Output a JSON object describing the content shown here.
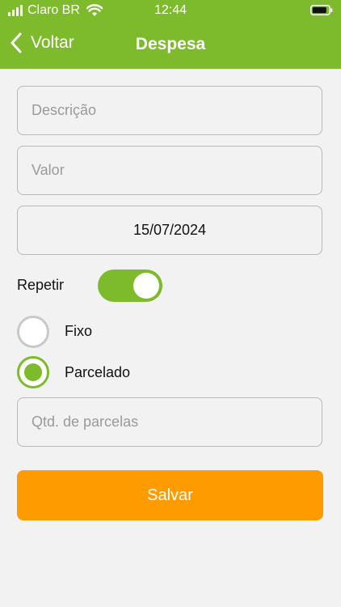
{
  "status_bar": {
    "carrier": "Claro BR",
    "time": "12:44",
    "icons": [
      "signal-icon",
      "wifi-icon",
      "battery-icon"
    ]
  },
  "nav": {
    "back_label": "Voltar",
    "title": "Despesa"
  },
  "form": {
    "descricao_placeholder": "Descrição",
    "valor_placeholder": "Valor",
    "date_value": "15/07/2024",
    "repetir_label": "Repetir",
    "repetir_on": true,
    "options": [
      {
        "label": "Fixo",
        "selected": false
      },
      {
        "label": "Parcelado",
        "selected": true
      }
    ],
    "parcelas_placeholder": "Qtd. de parcelas",
    "save_label": "Salvar"
  },
  "colors": {
    "primary_green": "#7dbb2c",
    "save_orange": "#fe9b00",
    "background": "#f2f2f2"
  }
}
